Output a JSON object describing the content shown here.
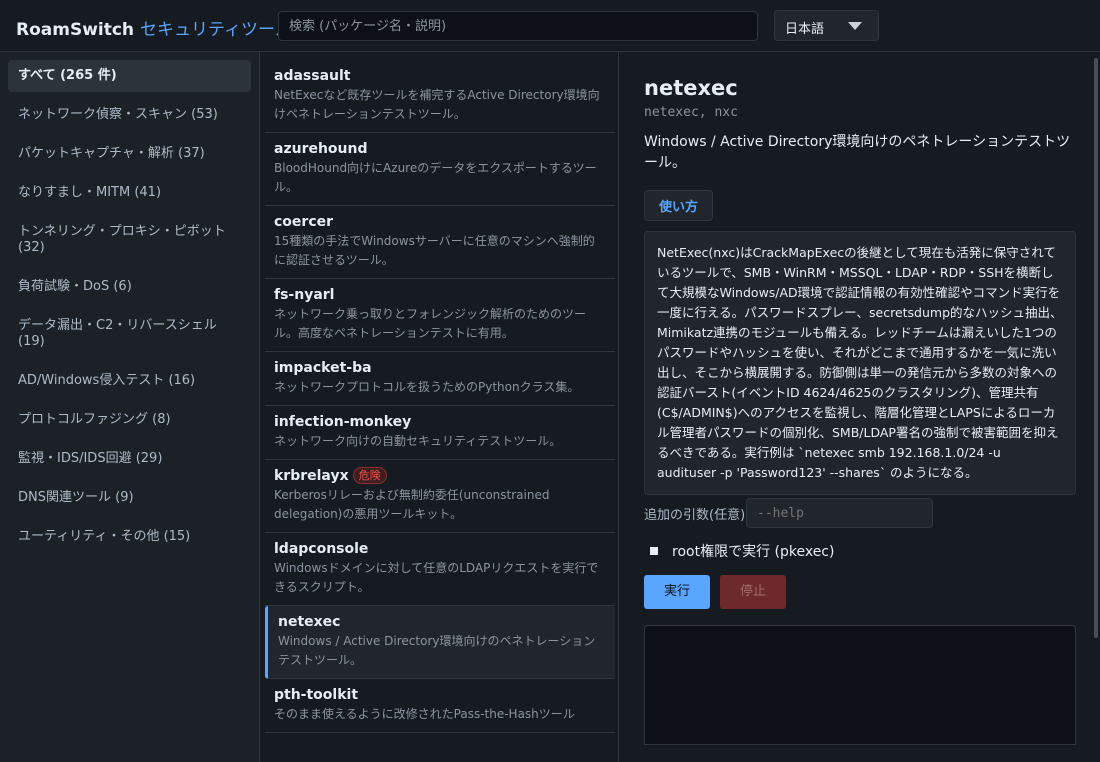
{
  "app": {
    "name": "RoamSwitch",
    "subtitle": "セキュリティツール"
  },
  "search": {
    "placeholder": "検索 (パッケージ名・説明)"
  },
  "language": {
    "selected": "日本語"
  },
  "categories": [
    {
      "label": "すべて (265 件)",
      "active": true
    },
    {
      "label": "ネットワーク偵察・スキャン (53)"
    },
    {
      "label": "パケットキャプチャ・解析 (37)"
    },
    {
      "label": "なりすまし・MITM (41)"
    },
    {
      "label": "トンネリング・プロキシ・ピボット (32)"
    },
    {
      "label": "負荷試験・DoS (6)"
    },
    {
      "label": "データ漏出・C2・リバースシェル (19)"
    },
    {
      "label": "AD/Windows侵入テスト (16)"
    },
    {
      "label": "プロトコルファジング (8)"
    },
    {
      "label": "監視・IDS/IDS回避 (29)"
    },
    {
      "label": "DNS関連ツール (9)"
    },
    {
      "label": "ユーティリティ・その他 (15)"
    }
  ],
  "tools": [
    {
      "name": "adassault",
      "desc": "NetExecなど既存ツールを補完するActive Directory環境向けペネトレーションテストツール。"
    },
    {
      "name": "azurehound",
      "desc": "BloodHound向けにAzureのデータをエクスポートするツール。"
    },
    {
      "name": "coercer",
      "desc": "15種類の手法でWindowsサーバーに任意のマシンへ強制的に認証させるツール。"
    },
    {
      "name": "fs-nyarl",
      "desc": "ネットワーク乗っ取りとフォレンジック解析のためのツール。高度なペネトレーションテストに有用。"
    },
    {
      "name": "impacket-ba",
      "desc": "ネットワークプロトコルを扱うためのPythonクラス集。"
    },
    {
      "name": "infection-monkey",
      "desc": "ネットワーク向けの自動セキュリティテストツール。"
    },
    {
      "name": "krbrelayx",
      "badge": "危険",
      "desc": "Kerberosリレーおよび無制約委任(unconstrained delegation)の悪用ツールキット。"
    },
    {
      "name": "ldapconsole",
      "desc": "Windowsドメインに対して任意のLDAPリクエストを実行できるスクリプト。"
    },
    {
      "name": "netexec",
      "desc": "Windows / Active Directory環境向けのペネトレーションテストツール。",
      "selected": true
    },
    {
      "name": "pth-toolkit",
      "desc": "そのまま使えるように改修されたPass-the-Hashツール"
    }
  ],
  "detail": {
    "title": "netexec",
    "aliases": "netexec, nxc",
    "description": "Windows / Active Directory環境向けのペネトレーションテストツール。",
    "usage_button": "使い方",
    "usage_text": "NetExec(nxc)はCrackMapExecの後継として現在も活発に保守されているツールで、SMB・WinRM・MSSQL・LDAP・RDP・SSHを横断して大規模なWindows/AD環境で認証情報の有効性確認やコマンド実行を一度に行える。パスワードスプレー、secretsdump的なハッシュ抽出、Mimikatz連携のモジュールも備える。レッドチームは漏えいした1つのパスワードやハッシュを使い、それがどこまで通用するかを一気に洗い出し、そこから横展開する。防御側は単一の発信元から多数の対象への認証バースト(イベントID 4624/4625のクラスタリング)、管理共有(C$/ADMIN$)へのアクセスを監視し、階層化管理とLAPSによるローカル管理者パスワードの個別化、SMB/LDAP署名の強制で被害範囲を抑えるべきである。実行例は `netexec smb 192.168.1.0/24 -u audituser -p 'Password123' --shares` のようになる。",
    "args_label": "追加の引数(任意)",
    "args_placeholder": "--help",
    "root_label": "root権限で実行 (pkexec)",
    "run_label": "実行",
    "stop_label": "停止"
  },
  "colors": {
    "accent": "#58a6ff",
    "danger": "#f85149",
    "background": "#161b22"
  }
}
